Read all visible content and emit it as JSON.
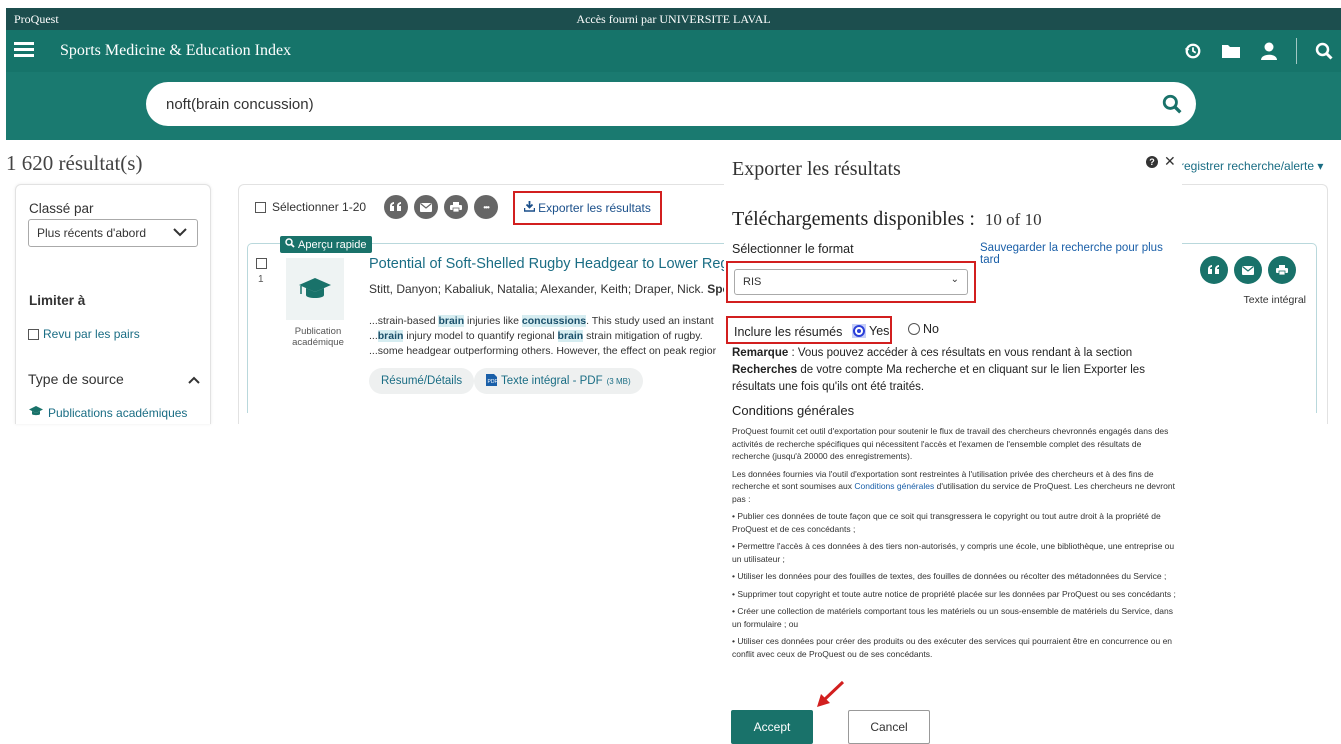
{
  "topbar": {
    "brand": "ProQuest",
    "access": "Accès fourni par UNIVERSITE LAVAL"
  },
  "nav": {
    "database": "Sports Medicine & Education Index",
    "icons": [
      "history-icon",
      "folder-icon",
      "user-icon",
      "search-icon"
    ]
  },
  "search": {
    "query": "noft(brain concussion)"
  },
  "results": {
    "count": "1 620 résultat(s)"
  },
  "left": {
    "sorted_by": "Classé par",
    "sort_value": "Plus récents d'abord",
    "limit": "Limiter à",
    "peer": "Revu par les pairs",
    "source_type": "Type de source",
    "academic": "Publications académiques"
  },
  "toolbar": {
    "select": "Sélectionner 1-20",
    "export": "Exporter les résultats",
    "more": "•••"
  },
  "result": {
    "preview": "Aperçu rapide",
    "num": "1",
    "pubtype": "Publication académique",
    "title": "Potential of Soft-Shelled Rugby Headgear to Lower Regional",
    "authors_plain": "Stitt, Danyon; Kabaliuk, Natalia; Alexander, Keith; Draper, Nick. ",
    "authors_bold": "Sport:",
    "s1a": "...strain-based ",
    "s1b": "brain",
    "s1c": " injuries like ",
    "s1d": "concussions",
    "s1e": ". This study used an instant",
    "s2a": "...",
    "s2b": "brain",
    "s2c": " injury model to quantify regional ",
    "s2d": "brain",
    "s2e": " strain mitigation of rugby.",
    "s3": "...some headgear outperforming others. However, the effect on peak regior",
    "summary_btn": "Résumé/Détails",
    "fulltext_btn": "Texte intégral - PDF",
    "fulltext_size": "(3 MB)",
    "fulltext_label": "Texte intégral"
  },
  "behind": {
    "save_alert": "registrer recherche/alerte ▾"
  },
  "modal": {
    "title": "Exporter les résultats",
    "downloads": "Téléchargements disponibles :",
    "downloads_count": "10 of 10",
    "format_label": "Sélectionner le format",
    "save_later": "Sauvegarder la recherche pour plus tard",
    "format_value": "RIS",
    "abstracts_label": "Inclure les résumés",
    "yes": "Yes",
    "no": "No",
    "remark_bold": "Remarque",
    "remark_a": " : Vous pouvez accéder à ces résultats en vous rendant à la section ",
    "remark_bold2": "Recherches",
    "remark_b": " de votre compte Ma recherche et en cliquant sur le lien Exporter les résultats une fois qu'ils ont été traités.",
    "conditions": "Conditions générales",
    "t1": "ProQuest fournit cet outil d'exportation pour soutenir le flux de travail des chercheurs chevronnés engagés dans des activités de recherche spécifiques qui nécessitent l'accès et l'examen de l'ensemble complet des résultats de recherche (jusqu'à 20000 des enregistrements).",
    "t2a": "Les données fournies via l'outil d'exportation sont restreintes à l'utilisation privée des chercheurs et à des fins de recherche et sont soumises aux ",
    "t2link": "Conditions générales",
    "t2b": " d'utilisation du service de ProQuest. Les chercheurs ne devront pas :",
    "b1": "• Publier ces données de toute façon que ce soit qui transgressera le copyright ou tout autre droit à la propriété de ProQuest et de ces concédants ;",
    "b2": "• Permettre l'accès à ces données à des tiers non-autorisés, y compris une école, une bibliothèque, une entreprise ou un utilisateur ;",
    "b3": "• Utiliser les données pour des fouilles de textes, des fouilles de données ou récolter des métadonnées du Service ;",
    "b4": "• Supprimer tout copyright et toute autre notice de propriété placée sur les données par ProQuest ou ses concédants ;",
    "b5": "• Créer une collection de matériels comportant tous les matériels ou un sous-ensemble de matériels du Service, dans un formulaire ; ou",
    "b6": "• Utiliser ces données pour créer des produits ou des exécuter des services qui pourraient être en concurrence ou en conflit avec ceux de ProQuest ou de ses concédants.",
    "accept": "Accept",
    "cancel": "Cancel"
  },
  "colors": {
    "teal_dark": "#1c4e4e",
    "teal": "#16746a",
    "highlight_box": "#d21f1f",
    "link": "#1a6d84"
  }
}
